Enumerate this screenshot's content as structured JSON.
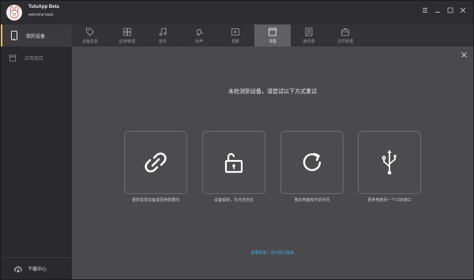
{
  "app": {
    "title": "TutuApp Beta",
    "subtitle": "welcome back"
  },
  "window_controls": [
    "menu-icon",
    "minimize-icon",
    "maximize-icon",
    "close-icon"
  ],
  "sidebar": {
    "items": [
      {
        "label": "我的设备",
        "icon": "phone-icon",
        "active": true
      },
      {
        "label": "应用商店",
        "icon": "store-icon",
        "active": false
      }
    ],
    "download_label": "下载中心"
  },
  "tabs": [
    {
      "label": "设备信息",
      "icon": "tag-icon"
    },
    {
      "label": "应用管理",
      "icon": "apps-icon"
    },
    {
      "label": "音乐",
      "icon": "music-icon"
    },
    {
      "label": "铃声",
      "icon": "bell-icon"
    },
    {
      "label": "视频",
      "icon": "video-icon"
    },
    {
      "label": "书签",
      "icon": "bookmark-icon",
      "active": true
    },
    {
      "label": "通讯录",
      "icon": "contacts-icon"
    },
    {
      "label": "文件管理",
      "icon": "briefcase-icon"
    }
  ],
  "main": {
    "heading": "未检测到设备，请尝试以下方式重试",
    "cards": [
      {
        "label": "重新拔插设备或更换数据线",
        "icon": "link-icon"
      },
      {
        "label": "设备解锁，并点击信任",
        "icon": "unlock-icon"
      },
      {
        "label": "重启电脑和手机手机",
        "icon": "refresh-icon"
      },
      {
        "label": "更换电脑另一个USB接口",
        "icon": "usb-icon"
      }
    ],
    "help_link": "需要帮助？请与我们联系"
  },
  "colors": {
    "accent": "#f0c430",
    "link": "#3fa6e8",
    "background": "#4a4a4d",
    "sidebar": "#2a2a2c"
  }
}
